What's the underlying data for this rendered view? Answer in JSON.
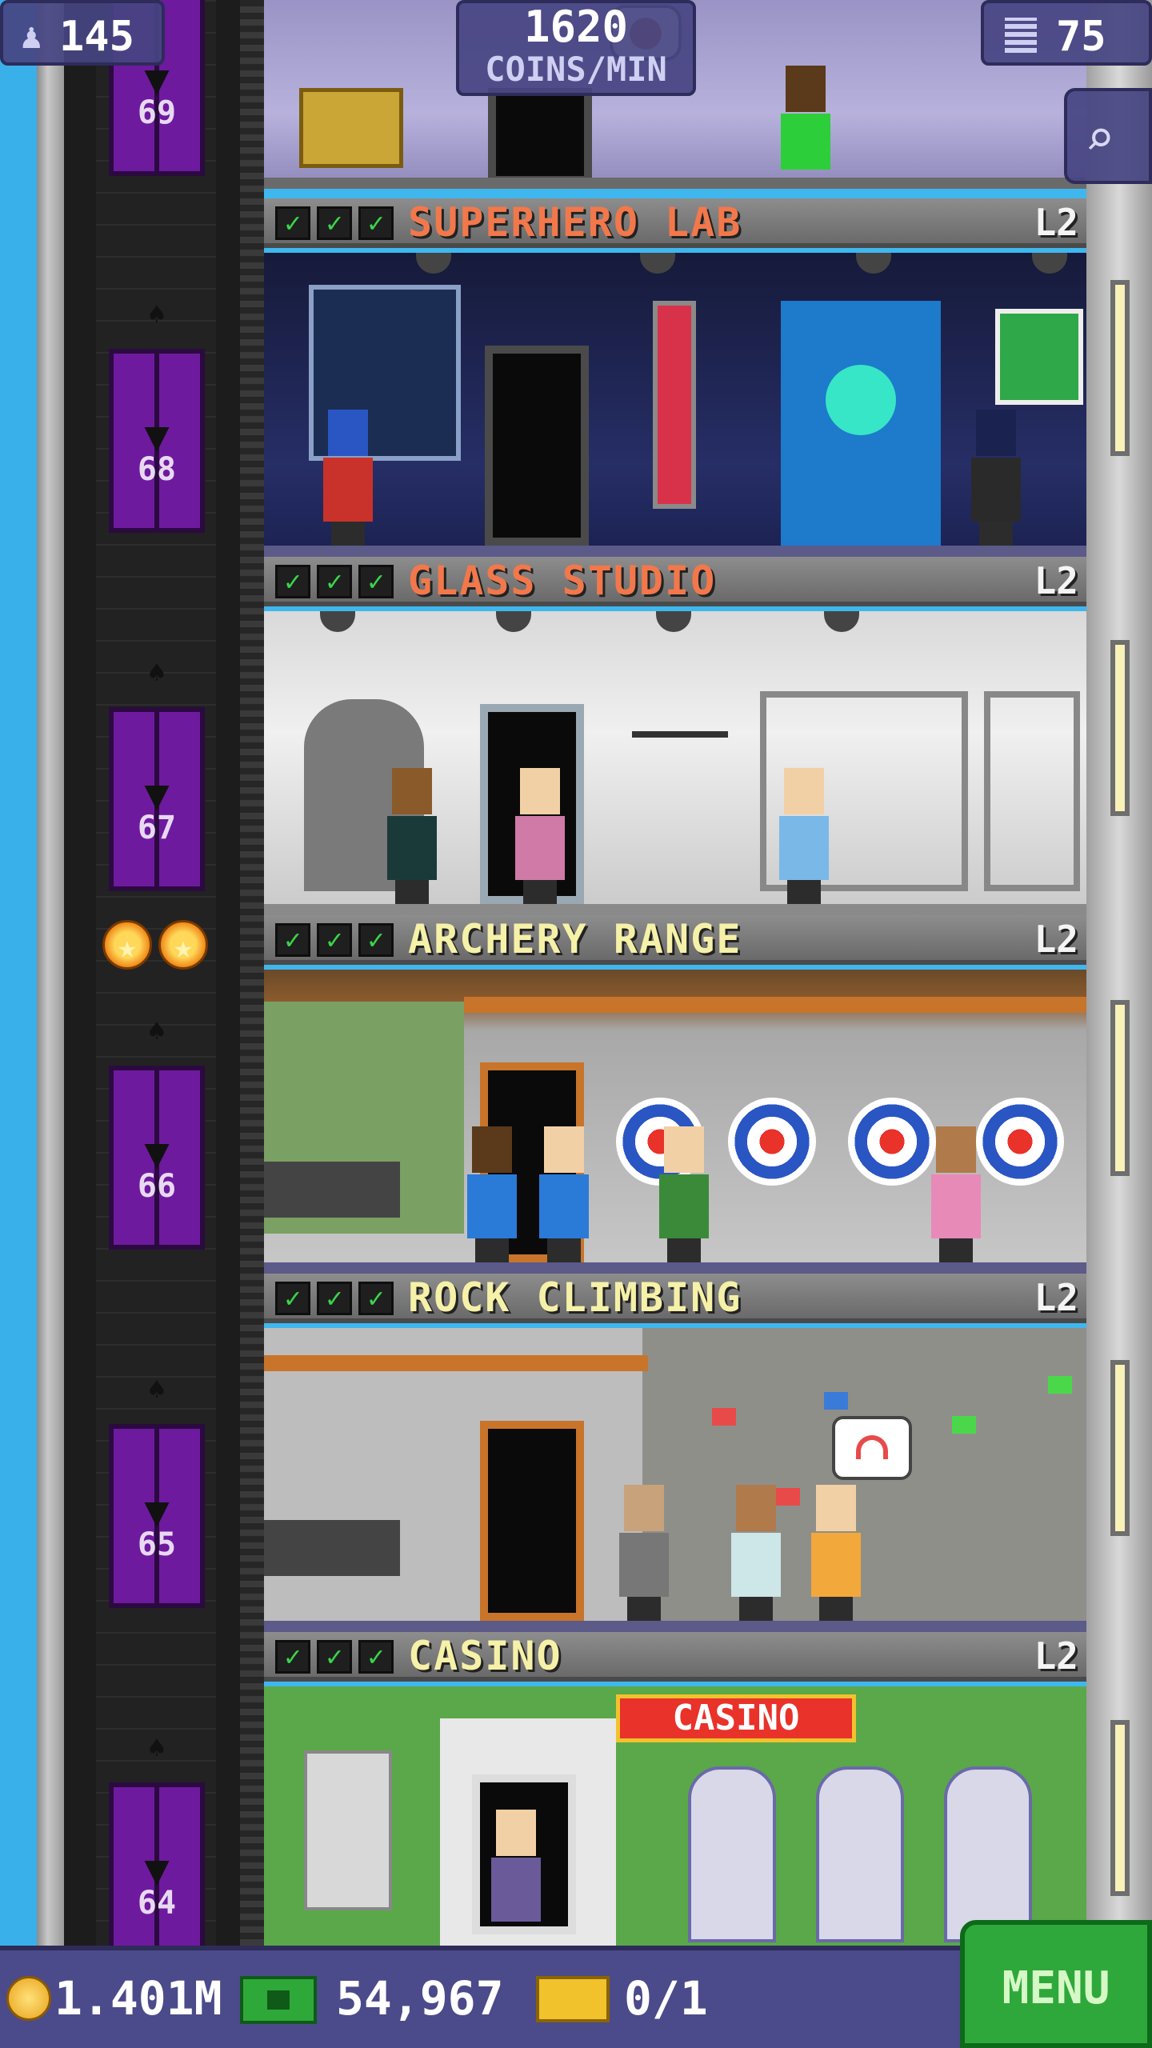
{
  "hud": {
    "population": "145",
    "coins_per_min_value": "1620",
    "coins_per_min_label": "COINS/MIN",
    "floors": "75"
  },
  "elevator": {
    "doors": [
      {
        "floor": "69"
      },
      {
        "floor": "68"
      },
      {
        "floor": "67"
      },
      {
        "floor": "66"
      },
      {
        "floor": "65"
      },
      {
        "floor": "64"
      }
    ]
  },
  "floors": [
    {
      "name": "SUPERHERO LAB",
      "level": "L2",
      "checks": 3,
      "name_color": "#f2784b"
    },
    {
      "name": "GLASS STUDIO",
      "level": "L2",
      "checks": 3,
      "name_color": "#f2784b"
    },
    {
      "name": "ARCHERY RANGE",
      "level": "L2",
      "checks": 3,
      "name_color": "#f6f1a8"
    },
    {
      "name": "ROCK CLIMBING",
      "level": "L2",
      "checks": 3,
      "name_color": "#f6f1a8"
    },
    {
      "name": "CASINO",
      "level": "L2",
      "checks": 3,
      "name_color": "#f6f1a8"
    }
  ],
  "casino_sign": "CASINO",
  "bottom_bar": {
    "coins": "1.401M",
    "bux": "54,967",
    "tickets": "0/1",
    "menu_label": "MENU"
  },
  "icons": {
    "population": "person-icon",
    "floors": "building-icon",
    "search": "magnifier-icon",
    "coin": "coin-icon",
    "bux": "bux-icon",
    "ticket": "ticket-icon",
    "vip": "star-icon"
  },
  "colors": {
    "hud_bg": "#46447f",
    "elevator_door": "#6e1a9e",
    "menu_green": "#2ea83a",
    "sky": "#3ab0ea"
  }
}
